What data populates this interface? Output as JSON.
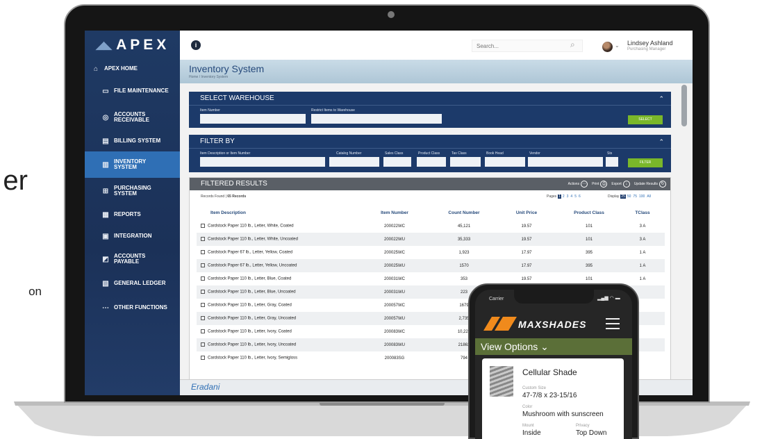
{
  "background_fragments": {
    "big": "er",
    "small": "on"
  },
  "app": {
    "brand": "APEX",
    "search_placeholder": "Search...",
    "user": {
      "name": "Lindsey Ashland",
      "role": "Purchasing Manager"
    },
    "page_title": "Inventory System",
    "breadcrumb": "Home / Inventory System",
    "footer_brand": "Eradani"
  },
  "sidebar": {
    "items": [
      {
        "label": "APEX HOME",
        "icon": "home-icon"
      },
      {
        "label": "FILE MAINTENANCE",
        "icon": "folder-icon"
      },
      {
        "label": "ACCOUNTS RECEIVABLE",
        "icon": "hand-coin-icon"
      },
      {
        "label": "BILLING SYSTEM",
        "icon": "invoice-icon"
      },
      {
        "label": "INVENTORY SYSTEM",
        "icon": "barcode-icon",
        "active": true
      },
      {
        "label": "PURCHASING SYSTEM",
        "icon": "cart-icon"
      },
      {
        "label": "REPORTS",
        "icon": "report-icon"
      },
      {
        "label": "INTEGRATION",
        "icon": "integration-icon"
      },
      {
        "label": "ACCOUNTS PAYABLE",
        "icon": "payable-icon"
      },
      {
        "label": "GENERAL LEDGER",
        "icon": "ledger-icon"
      },
      {
        "label": "OTHER FUNCTIONS",
        "icon": "more-icon"
      }
    ]
  },
  "select_warehouse": {
    "title": "SELECT WAREHOUSE",
    "item_number_label": "Item Number",
    "restrict_label": "Restrict Items to Warehouse",
    "button": "SELECT"
  },
  "filter_by": {
    "title": "FILTER BY",
    "labels": {
      "desc": "Item Description or Item Number",
      "catalog": "Catalog Number",
      "sales": "Sales Class",
      "product": "Product Class",
      "tax": "Tax Class",
      "book": "Book Head",
      "vendor": "Vendor",
      "sts": "Sts"
    },
    "button": "FILTER"
  },
  "results": {
    "title": "FILTERED RESULTS",
    "actions": [
      "Actions",
      "Print",
      "Export",
      "Update Results"
    ],
    "records_label": "Records Found |",
    "records_count": "65 Records",
    "pages_label": "Pages",
    "pages": [
      "1",
      "2",
      "3",
      "4",
      "5",
      "6"
    ],
    "display_label": "Display",
    "display_options": [
      "25",
      "50",
      "75",
      "100",
      "All"
    ],
    "columns": [
      "Item Description",
      "Item Number",
      "Count Number",
      "Unit Price",
      "Product Class",
      "TClass"
    ],
    "rows": [
      [
        "Cardstock Paper 110 lb., Letter, White, Coated",
        "200022WC",
        "45,121",
        "19.57",
        "101",
        "3 A"
      ],
      [
        "Cardstock Paper 110 lb., Letter, White, Uncoated",
        "200022WU",
        "35,333",
        "19.57",
        "101",
        "3 A"
      ],
      [
        "Cardstock Paper 67 lb., Letter, Yellow, Coated",
        "200025WC",
        "1,923",
        "17.97",
        "395",
        "1 A"
      ],
      [
        "Cardstock Paper 67 lb., Letter, Yellow, Uncoated",
        "200025WU",
        "1570",
        "17.97",
        "395",
        "1 A"
      ],
      [
        "Cardstock Paper 110 lb., Letter, Blue, Coated",
        "200031WC",
        "353",
        "19.57",
        "101",
        "1 A"
      ],
      [
        "Cardstock Paper 110 lb., Letter, Blue, Uncoated",
        "200031WU",
        "223",
        "",
        "",
        ""
      ],
      [
        "Cardstock Paper 110 lb., Letter, Gray, Coated",
        "200057WC",
        "1679",
        "",
        "",
        ""
      ],
      [
        "Cardstock Paper 110 lb., Letter, Gray, Uncoated",
        "200057WU",
        "2,735",
        "",
        "",
        ""
      ],
      [
        "Cardstock Paper 110 lb., Letter, Ivory, Coated",
        "200083WC",
        "10,222",
        "",
        "",
        ""
      ],
      [
        "Cardstock Paper 110 lb., Letter, Ivory, Uncoated",
        "200083WU",
        "21863",
        "",
        "",
        ""
      ],
      [
        "Cardstock Paper 110 lb., Letter, Ivory, Semigloss",
        "200083SG",
        "794",
        "",
        "",
        ""
      ]
    ]
  },
  "phone": {
    "carrier": "Carrier",
    "brand": "MAXSHADES",
    "view_options": "View Options",
    "product": "Cellular Shade",
    "size_label": "Custom Size",
    "size_value": "47-7/8 x 23-15/16",
    "color_label": "Color",
    "color_value": "Mushroom with sunscreen",
    "mount_label": "Mount",
    "mount_value": "Inside",
    "privacy_label": "Privacy",
    "privacy_value": "Top Down",
    "accent": "#f08a1c",
    "bar_color": "#5b6f38"
  }
}
